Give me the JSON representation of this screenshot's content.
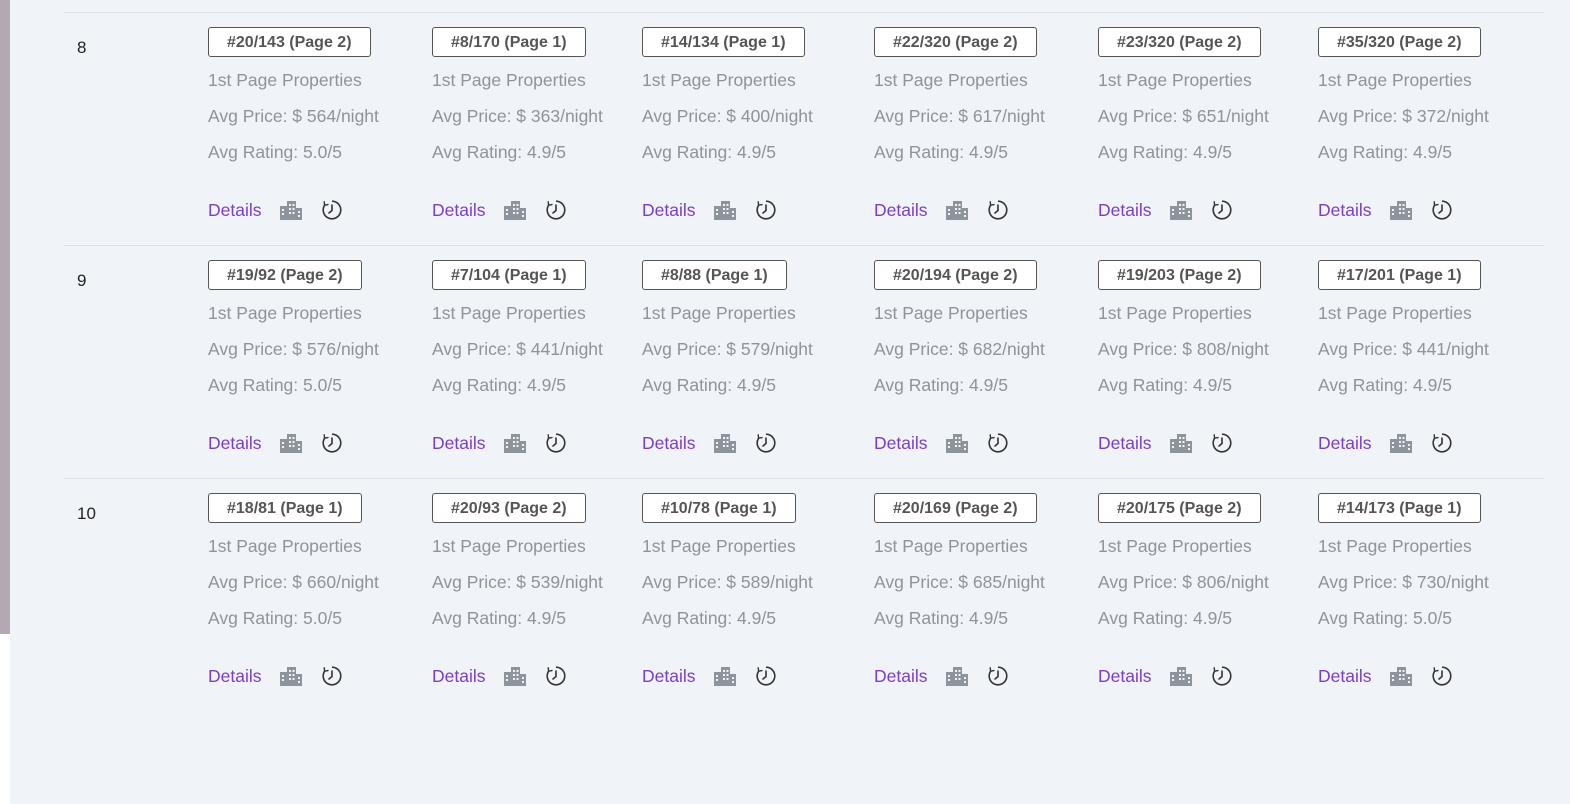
{
  "labels": {
    "first_page": "1st Page Properties",
    "details": "Details"
  },
  "colors": {
    "link": "#7b3fc4",
    "muted_text": "#8e949b",
    "background": "#f0f3f7"
  },
  "icons": {
    "building": "building-icon",
    "history": "history-clock-icon"
  },
  "rows": [
    {
      "index": "8",
      "cells": [
        {
          "rank": "#20/143 (Page 2)",
          "price": "Avg Price: $ 564/night",
          "rating": "Avg Rating: 5.0/5"
        },
        {
          "rank": "#8/170 (Page 1)",
          "price": "Avg Price: $ 363/night",
          "rating": "Avg Rating: 4.9/5"
        },
        {
          "rank": "#14/134 (Page 1)",
          "price": "Avg Price: $ 400/night",
          "rating": "Avg Rating: 4.9/5"
        },
        {
          "rank": "#22/320 (Page 2)",
          "price": "Avg Price: $ 617/night",
          "rating": "Avg Rating: 4.9/5"
        },
        {
          "rank": "#23/320 (Page 2)",
          "price": "Avg Price: $ 651/night",
          "rating": "Avg Rating: 4.9/5"
        },
        {
          "rank": "#35/320 (Page 2)",
          "price": "Avg Price: $ 372/night",
          "rating": "Avg Rating: 4.9/5"
        }
      ]
    },
    {
      "index": "9",
      "cells": [
        {
          "rank": "#19/92 (Page 2)",
          "price": "Avg Price: $ 576/night",
          "rating": "Avg Rating: 5.0/5"
        },
        {
          "rank": "#7/104 (Page 1)",
          "price": "Avg Price: $ 441/night",
          "rating": "Avg Rating: 4.9/5"
        },
        {
          "rank": "#8/88 (Page 1)",
          "price": "Avg Price: $ 579/night",
          "rating": "Avg Rating: 4.9/5"
        },
        {
          "rank": "#20/194 (Page 2)",
          "price": "Avg Price: $ 682/night",
          "rating": "Avg Rating: 4.9/5"
        },
        {
          "rank": "#19/203 (Page 2)",
          "price": "Avg Price: $ 808/night",
          "rating": "Avg Rating: 4.9/5"
        },
        {
          "rank": "#17/201 (Page 1)",
          "price": "Avg Price: $ 441/night",
          "rating": "Avg Rating: 4.9/5"
        }
      ]
    },
    {
      "index": "10",
      "cells": [
        {
          "rank": "#18/81 (Page 1)",
          "price": "Avg Price: $ 660/night",
          "rating": "Avg Rating: 5.0/5"
        },
        {
          "rank": "#20/93 (Page 2)",
          "price": "Avg Price: $ 539/night",
          "rating": "Avg Rating: 4.9/5"
        },
        {
          "rank": "#10/78 (Page 1)",
          "price": "Avg Price: $ 589/night",
          "rating": "Avg Rating: 4.9/5"
        },
        {
          "rank": "#20/169 (Page 2)",
          "price": "Avg Price: $ 685/night",
          "rating": "Avg Rating: 4.9/5"
        },
        {
          "rank": "#20/175 (Page 2)",
          "price": "Avg Price: $ 806/night",
          "rating": "Avg Rating: 4.9/5"
        },
        {
          "rank": "#14/173 (Page 1)",
          "price": "Avg Price: $ 730/night",
          "rating": "Avg Rating: 5.0/5"
        }
      ]
    }
  ]
}
